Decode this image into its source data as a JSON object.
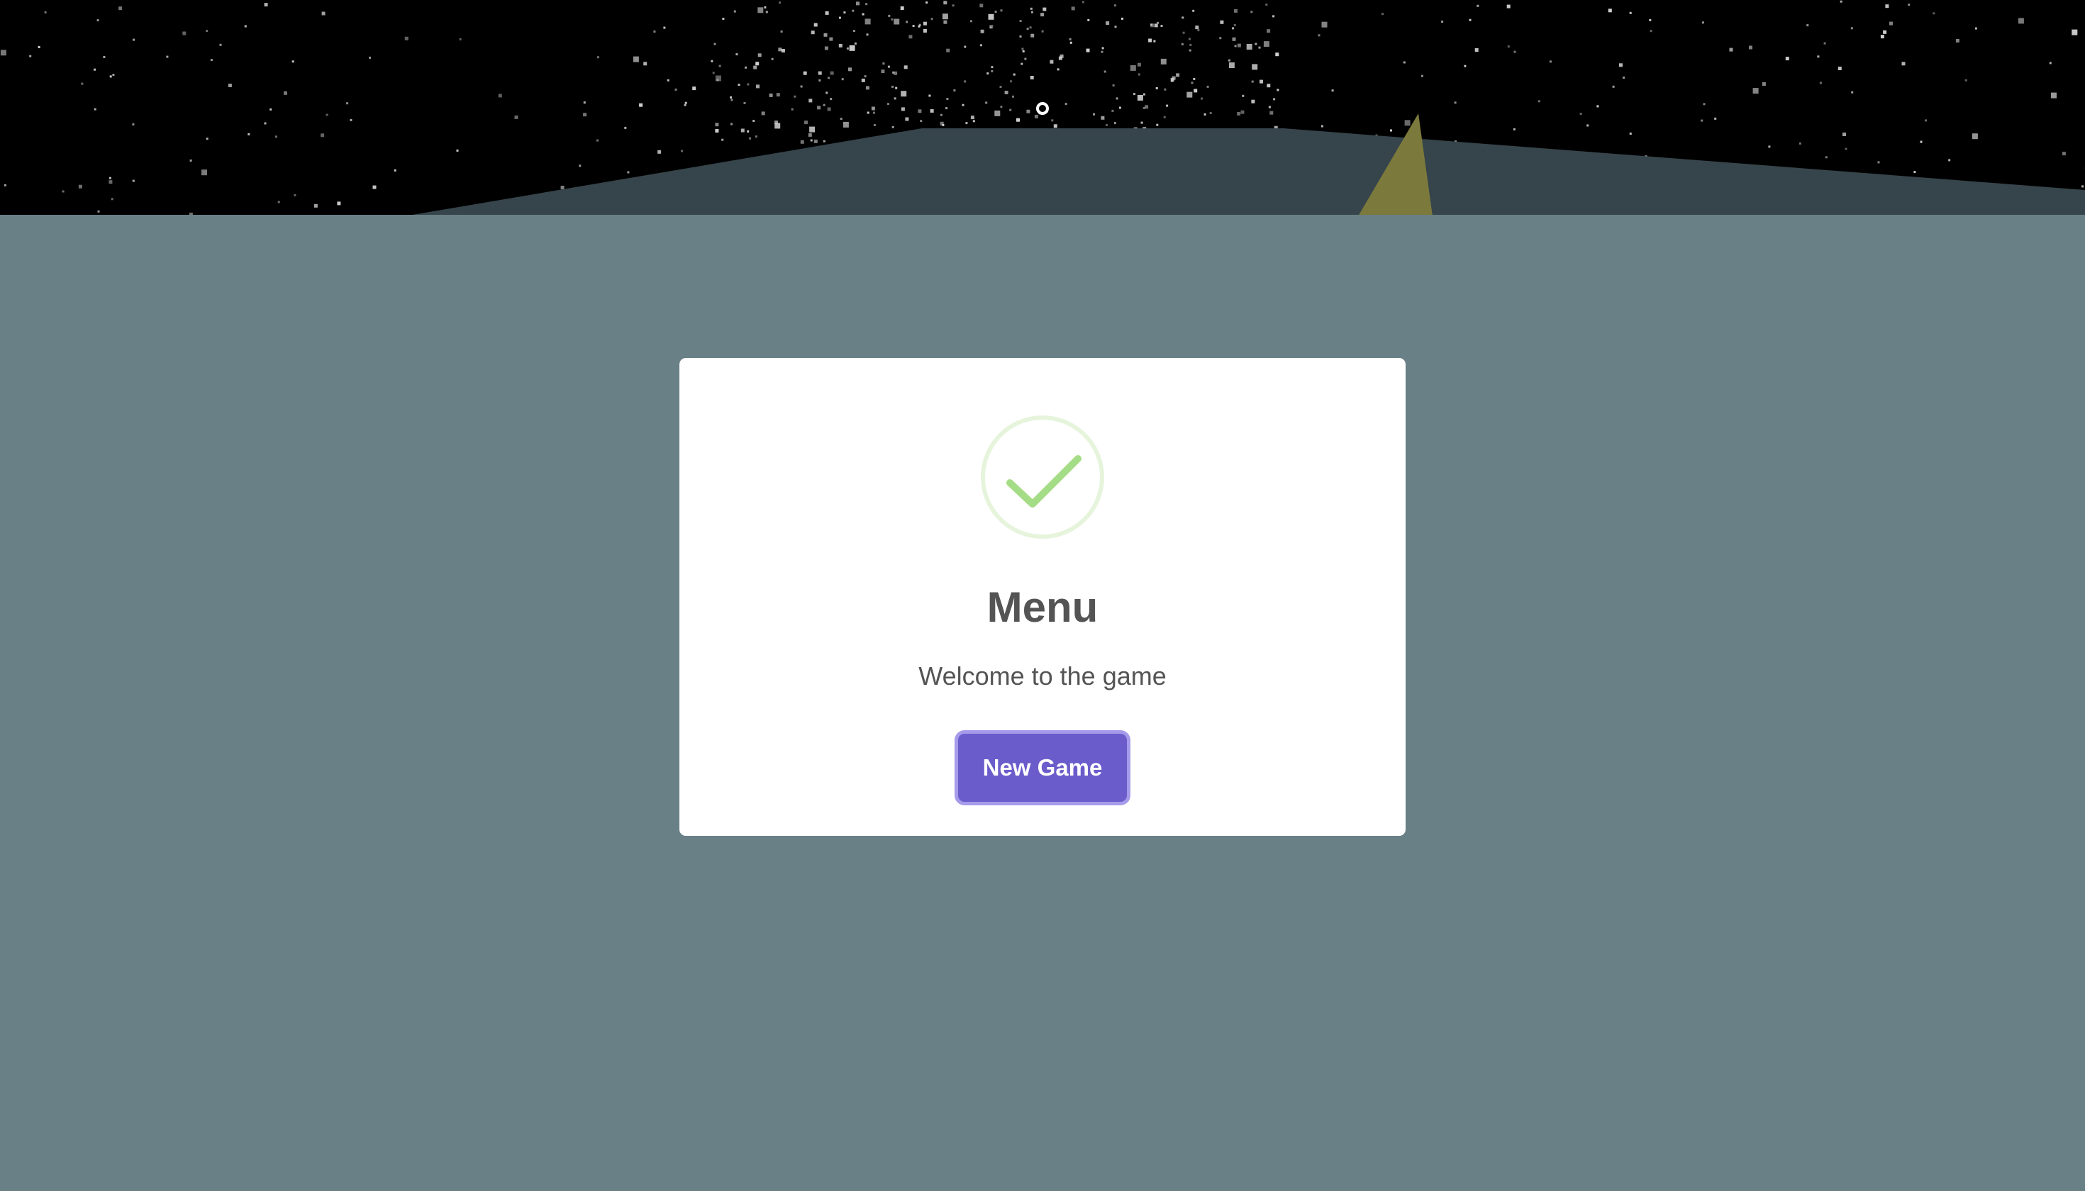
{
  "modal": {
    "title": "Menu",
    "message": "Welcome to the game",
    "confirm_label": "New Game",
    "icon": "checkmark-success-icon"
  },
  "colors": {
    "sky": "#000000",
    "star": "#cfcfcf",
    "ground": "#6a8087",
    "far_terrain": "#36444b",
    "yellow_shard": "#7b7a3c",
    "modal_bg": "#ffffff",
    "text": "#545454",
    "button": "#6a5ccb",
    "button_focus_ring": "#968ae8",
    "check_ring": "#e6f4dc",
    "check_mark": "#a5dc86"
  }
}
